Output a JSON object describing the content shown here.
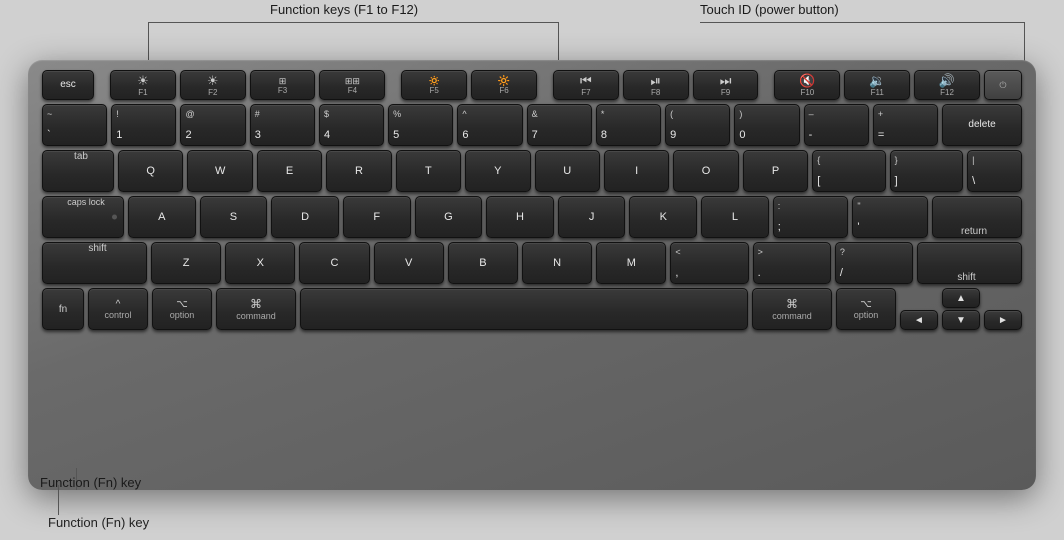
{
  "annotations": {
    "function_keys_label": "Function keys (F1 to F12)",
    "touchid_label": "Touch ID (power button)",
    "fn_key_label": "Function (Fn) key"
  },
  "keyboard": {
    "rows": {
      "fn_row": [
        "esc",
        "F1",
        "F2",
        "F3",
        "F4",
        "F5",
        "F6",
        "F7",
        "F8",
        "F9",
        "F10",
        "F11",
        "F12",
        ""
      ],
      "number_row": [
        "~\n`",
        "!\n1",
        "@\n2",
        "#\n3",
        "$\n4",
        "%\n5",
        "^\n6",
        "&\n7",
        "*\n8",
        "(\n9",
        ")\n0",
        "–\n-",
        "+\n=",
        "delete"
      ],
      "tab_row": [
        "tab",
        "Q",
        "W",
        "E",
        "R",
        "T",
        "Y",
        "U",
        "I",
        "O",
        "P",
        "{\n[",
        "}\n]",
        "|\n\\"
      ],
      "caps_row": [
        "caps lock",
        "A",
        "S",
        "D",
        "F",
        "G",
        "H",
        "J",
        "K",
        "L",
        ":\n;",
        "\"\n'",
        "return"
      ],
      "shift_row": [
        "shift",
        "Z",
        "X",
        "C",
        "V",
        "B",
        "N",
        "M",
        "<\n,",
        ">\n.",
        "?\n/",
        "shift"
      ],
      "bottom_row": [
        "fn",
        "control",
        "option",
        "command",
        "",
        "command",
        "option",
        "◄",
        "▲▼",
        "►"
      ]
    }
  }
}
